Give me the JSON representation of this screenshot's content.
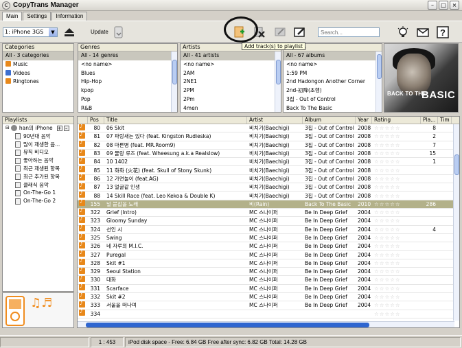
{
  "window": {
    "title": "CopyTrans Manager"
  },
  "tabs": [
    "Main",
    "Settings",
    "Information"
  ],
  "toolbar": {
    "device": "1: iPhone 3GS",
    "update_label": "Update",
    "search_placeholder": "Search...",
    "tooltip": "Add track(s) to playlist"
  },
  "categories": {
    "header": "Categories",
    "items": [
      "All - 3 categories",
      "Music",
      "Videos",
      "Ringtones"
    ]
  },
  "genres": {
    "header": "Genres",
    "items": [
      "All - 14 genres",
      "<no name>",
      "Blues",
      "Hip-Hop",
      "kpop",
      "Pop",
      "R&B"
    ]
  },
  "artists": {
    "header": "Artists",
    "items": [
      "All - 41 artists",
      "<no name>",
      "2AM",
      "2NE1",
      "2PM",
      "2Pm",
      "4men"
    ]
  },
  "albums": {
    "header": "Albums",
    "items": [
      "All - 67 albums",
      "<no name>",
      "1:59 PM",
      "2nd Hadongon Another Corner",
      "2nd-初降(초행)",
      "3집 - Out of Control",
      "Back To The Basic"
    ]
  },
  "album_art": {
    "title_text": "BACK TO THE",
    "big_text": "BASIC"
  },
  "playlists": {
    "header": "Playlists",
    "root": "han의 iPhone",
    "items": [
      "90년대 음악",
      "많이 재생한 음...",
      "뮤직 비디오",
      "좋아하는 음악",
      "최근 재생된 항목",
      "최근 추가된 항목",
      "클래식 음악",
      "On-The-Go 1",
      "On-The-Go 2"
    ]
  },
  "tracks": {
    "columns": [
      "Pos",
      "Title",
      "Artist",
      "Album",
      "Year",
      "Rating",
      "Pla...",
      "Tim"
    ],
    "rows": [
      {
        "pos": "80",
        "title": "06 Skit",
        "artist": "비치기(Baechigi)",
        "album": "3집 - Out of Control",
        "year": "2008",
        "plays": "8"
      },
      {
        "pos": "81",
        "title": "07 파랑새는 있다 (feat. Kingston Rudieska)",
        "artist": "비치기(Baechigi)",
        "album": "3집 - Out of Control",
        "year": "2008",
        "plays": "2"
      },
      {
        "pos": "82",
        "title": "08 마른병 (feat. MR.Room9)",
        "artist": "비치기(Baechigi)",
        "album": "3집 - Out of Control",
        "year": "2008",
        "plays": "7"
      },
      {
        "pos": "83",
        "title": "09 물랑 루즈 (feat. Wheesung a.k.a Realslow)",
        "artist": "비치기(Baechigi)",
        "album": "3집 - Out of Control",
        "year": "2008",
        "plays": "15"
      },
      {
        "pos": "84",
        "title": "10 1402",
        "artist": "비치기(Baechigi)",
        "album": "3집 - Out of Control",
        "year": "2008",
        "plays": "1"
      },
      {
        "pos": "85",
        "title": "11 화화 (火花) (feat. Skull of Stony Skunk)",
        "artist": "비치기(Baechigi)",
        "album": "3집 - Out of Control",
        "year": "2008",
        "plays": ""
      },
      {
        "pos": "86",
        "title": "12 가면놀이 (feat.AG)",
        "artist": "비치기(Baechigi)",
        "album": "3집 - Out of Control",
        "year": "2008",
        "plays": ""
      },
      {
        "pos": "87",
        "title": "13 얼굴같 인생",
        "artist": "비치기(Baechigi)",
        "album": "3집 - Out of Control",
        "year": "2008",
        "plays": ""
      },
      {
        "pos": "88",
        "title": "14 Skill Race (feat. Leo Kekoa & Double K)",
        "artist": "비치기(Baechigi)",
        "album": "3집 - Out of Control",
        "year": "2008",
        "plays": ""
      },
      {
        "pos": "155",
        "title": "널 붙잡을 노래",
        "artist": "비(Rain)",
        "album": "Back To The Basic",
        "year": "2010",
        "plays": "286",
        "selected": true
      },
      {
        "pos": "322",
        "title": "Grief (Intro)",
        "artist": "MC 스나이퍼",
        "album": "Be In Deep Grief",
        "year": "2004",
        "plays": ""
      },
      {
        "pos": "323",
        "title": "Gloomy Sunday",
        "artist": "MC 스나이퍼",
        "album": "Be In Deep Grief",
        "year": "2004",
        "plays": ""
      },
      {
        "pos": "324",
        "title": "선인 시",
        "artist": "MC 스나이퍼",
        "album": "Be In Deep Grief",
        "year": "2004",
        "plays": "4"
      },
      {
        "pos": "325",
        "title": "Swing",
        "artist": "MC 스나이퍼",
        "album": "Be In Deep Grief",
        "year": "2004",
        "plays": ""
      },
      {
        "pos": "326",
        "title": "네 자루의 M.I.C.",
        "artist": "MC 스나이퍼",
        "album": "Be In Deep Grief",
        "year": "2004",
        "plays": ""
      },
      {
        "pos": "327",
        "title": "Puregal",
        "artist": "MC 스나이퍼",
        "album": "Be In Deep Grief",
        "year": "2004",
        "plays": ""
      },
      {
        "pos": "328",
        "title": "Skit #1",
        "artist": "MC 스나이퍼",
        "album": "Be In Deep Grief",
        "year": "2004",
        "plays": ""
      },
      {
        "pos": "329",
        "title": "Seoul Station",
        "artist": "MC 스나이퍼",
        "album": "Be In Deep Grief",
        "year": "2004",
        "plays": ""
      },
      {
        "pos": "330",
        "title": "대화",
        "artist": "MC 스나이퍼",
        "album": "Be In Deep Grief",
        "year": "2004",
        "plays": ""
      },
      {
        "pos": "331",
        "title": "Scarface",
        "artist": "MC 스나이퍼",
        "album": "Be In Deep Grief",
        "year": "2004",
        "plays": ""
      },
      {
        "pos": "332",
        "title": "Skit #2",
        "artist": "MC 스나이퍼",
        "album": "Be In Deep Grief",
        "year": "2004",
        "plays": ""
      },
      {
        "pos": "333",
        "title": "서울을 떠나며",
        "artist": "MC 스나이퍼",
        "album": "Be In Deep Grief",
        "year": "2004",
        "plays": ""
      },
      {
        "pos": "334",
        "title": "",
        "artist": "",
        "album": "",
        "year": "",
        "plays": ""
      }
    ],
    "rating_empty": "☆☆☆☆☆"
  },
  "status": {
    "count": "1 : 453",
    "disk": "iPod disk space - Free: 6.84 GB Free after sync: 6.82 GB Total: 14.28 GB"
  },
  "colors": {
    "accent_orange": "#e8881a",
    "selection": "#b3b18a",
    "scroll_blue": "#2f66d0"
  }
}
